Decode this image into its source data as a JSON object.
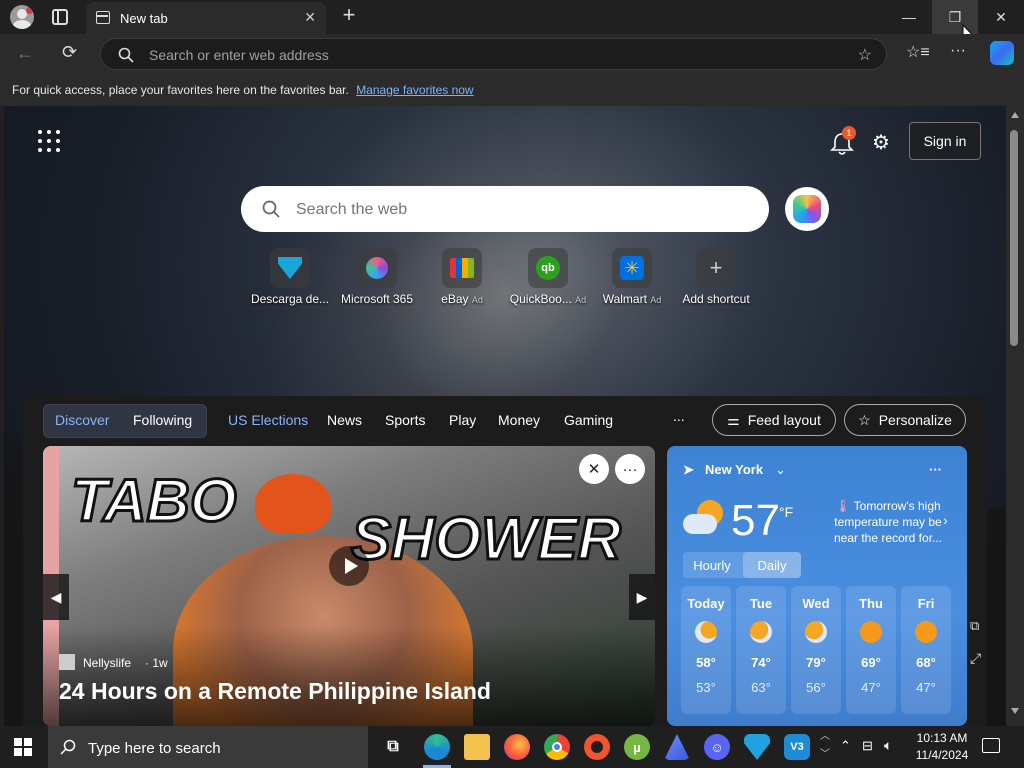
{
  "browser": {
    "tab_title": "New tab",
    "address_placeholder": "Search or enter web address",
    "favorites_bar_text": "For quick access, place your favorites here on the favorites bar.",
    "favorites_bar_link": "Manage favorites now"
  },
  "newtab": {
    "notification_count": "1",
    "signin_label": "Sign in",
    "search_placeholder": "Search the web",
    "shortcuts": [
      {
        "label": "Descarga de...",
        "ad": ""
      },
      {
        "label": "Microsoft 365",
        "ad": ""
      },
      {
        "label": "eBay",
        "ad": "Ad"
      },
      {
        "label": "QuickBoo...",
        "ad": "Ad"
      },
      {
        "label": "Walmart",
        "ad": "Ad"
      },
      {
        "label": "Add shortcut",
        "ad": ""
      }
    ]
  },
  "feed": {
    "tabs": [
      "Discover",
      "Following",
      "US Elections",
      "News",
      "Sports",
      "Play",
      "Money",
      "Gaming"
    ],
    "more": "...",
    "feed_layout": "Feed layout",
    "personalize": "Personalize",
    "hero": {
      "image_words": [
        "TABO",
        "SHOWER"
      ],
      "source": "Nellyslife",
      "age": "· 1w",
      "title": "24 Hours on a Remote Philippine Island"
    }
  },
  "weather": {
    "location": "New York",
    "temperature": "57",
    "unit": "°F",
    "note": "Tomorrow's high temperature may be near the record for...",
    "tabs": [
      "Hourly",
      "Daily"
    ],
    "days": [
      {
        "name": "Today",
        "high": "58°",
        "low": "53°",
        "icon": "partly-cloudy-icon"
      },
      {
        "name": "Tue",
        "high": "74°",
        "low": "63°",
        "icon": "partly-cloudy-icon"
      },
      {
        "name": "Wed",
        "high": "79°",
        "low": "56°",
        "icon": "partly-cloudy-icon"
      },
      {
        "name": "Thu",
        "high": "69°",
        "low": "47°",
        "icon": "sunny-icon"
      },
      {
        "name": "Fri",
        "high": "68°",
        "low": "47°",
        "icon": "sunny-icon"
      }
    ]
  },
  "taskbar": {
    "search_placeholder": "Type here to search",
    "time": "10:13 AM",
    "date": "11/4/2024"
  }
}
